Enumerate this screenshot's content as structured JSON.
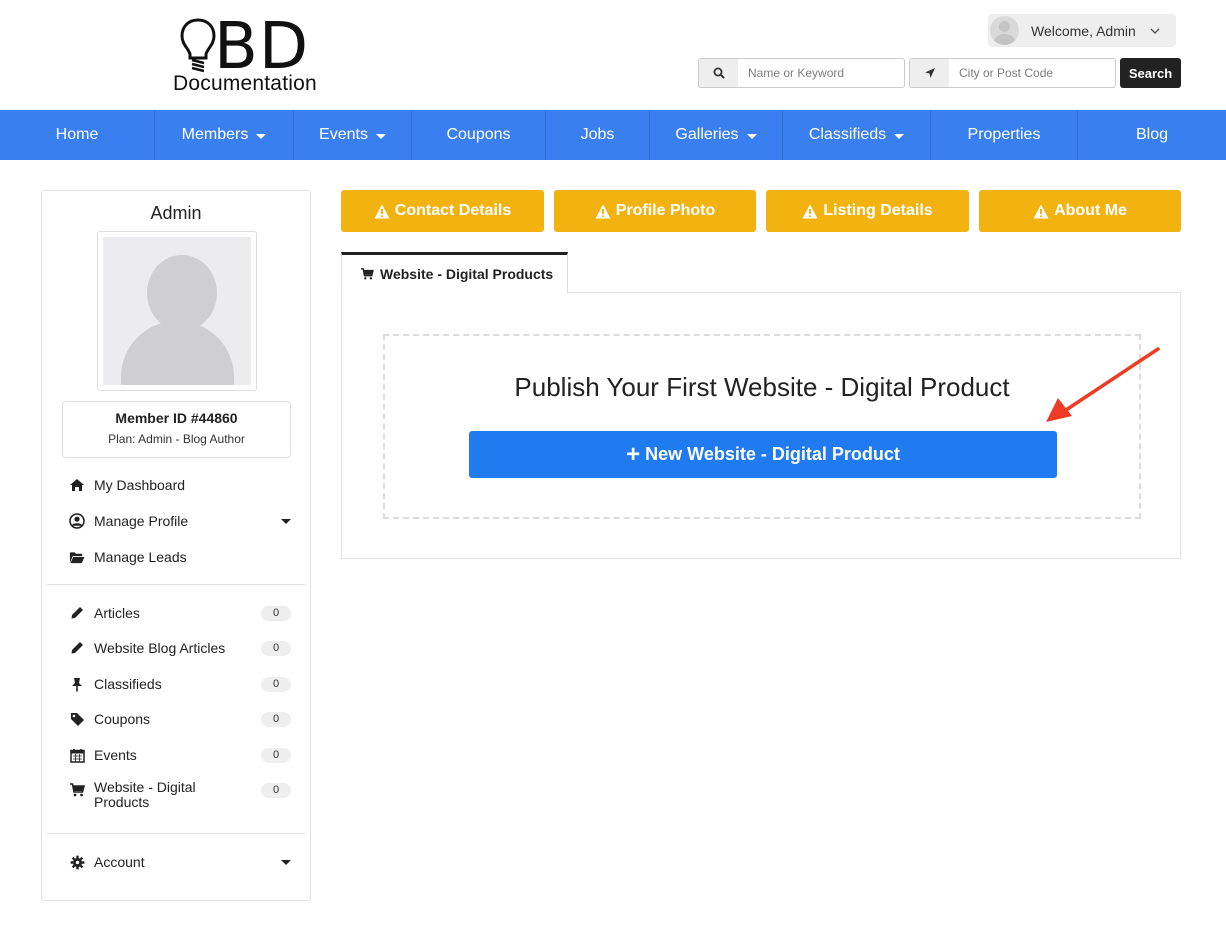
{
  "header": {
    "logo_main": "BD",
    "logo_sub": "Documentation",
    "welcome_text": "Welcome, Admin",
    "search_keyword_placeholder": "Name or Keyword",
    "search_location_placeholder": "City or Post Code",
    "search_button": "Search"
  },
  "nav": {
    "items": [
      {
        "label": "Home",
        "dropdown": false
      },
      {
        "label": "Members",
        "dropdown": true
      },
      {
        "label": "Events",
        "dropdown": true
      },
      {
        "label": "Coupons",
        "dropdown": false
      },
      {
        "label": "Jobs",
        "dropdown": false
      },
      {
        "label": "Galleries",
        "dropdown": true
      },
      {
        "label": "Classifieds",
        "dropdown": true
      },
      {
        "label": "Properties",
        "dropdown": false
      },
      {
        "label": "Blog",
        "dropdown": false
      }
    ]
  },
  "sidebar": {
    "title": "Admin",
    "member_id": "Member ID #44860",
    "plan": "Plan: Admin - Blog Author",
    "menu": [
      {
        "label": "My Dashboard",
        "icon": "home-icon"
      },
      {
        "label": "Manage Profile",
        "icon": "user-circle-icon"
      },
      {
        "label": "Manage Leads",
        "icon": "folder-open-icon"
      }
    ],
    "content_items": [
      {
        "label": "Articles",
        "count": "0",
        "icon": "pencil-icon"
      },
      {
        "label": "Website Blog Articles",
        "count": "0",
        "icon": "pencil-icon"
      },
      {
        "label": "Classifieds",
        "count": "0",
        "icon": "pushpin-icon"
      },
      {
        "label": "Coupons",
        "count": "0",
        "icon": "tag-icon"
      },
      {
        "label": "Events",
        "count": "0",
        "icon": "calendar-icon"
      },
      {
        "label": "Website - Digital",
        "label_line2": "Products",
        "count": "0",
        "icon": "cart-icon"
      }
    ],
    "account": "Account"
  },
  "alerts": [
    {
      "label": "Contact Details"
    },
    {
      "label": "Profile Photo"
    },
    {
      "label": "Listing Details"
    },
    {
      "label": "About Me"
    }
  ],
  "main": {
    "tab_label": "Website - Digital Products",
    "publish_title": "Publish Your First Website - Digital Product",
    "new_button": "New Website - Digital Product"
  },
  "colors": {
    "nav_blue": "#3a7ff0",
    "alert_yellow": "#f2b311",
    "primary_button": "#1f7bef",
    "annotation_arrow": "#ee3b24"
  }
}
